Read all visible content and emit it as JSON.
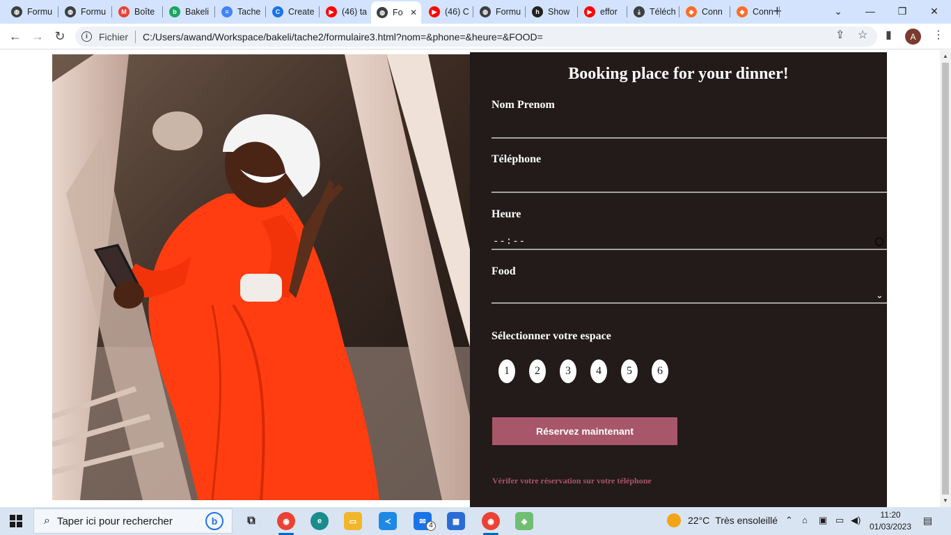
{
  "browser": {
    "tabs": [
      {
        "title": "Formu",
        "fav_color": "#3c4043",
        "fav_glyph": "◍"
      },
      {
        "title": "Formu",
        "fav_color": "#3c4043",
        "fav_glyph": "◍"
      },
      {
        "title": "Boîte",
        "fav_color": "#ea4335",
        "fav_glyph": "M"
      },
      {
        "title": "Bakeli",
        "fav_color": "#1ea362",
        "fav_glyph": "b"
      },
      {
        "title": "Tache",
        "fav_color": "#4285f4",
        "fav_glyph": "≡"
      },
      {
        "title": "Create",
        "fav_color": "#1a73e8",
        "fav_glyph": "C"
      },
      {
        "title": "(46) ta",
        "fav_color": "#ff0000",
        "fav_glyph": "▶"
      },
      {
        "title": "Fo",
        "fav_color": "#3c4043",
        "fav_glyph": "◍",
        "active": true
      },
      {
        "title": "(46) C",
        "fav_color": "#ff0000",
        "fav_glyph": "▶"
      },
      {
        "title": "Formu",
        "fav_color": "#3c4043",
        "fav_glyph": "◍"
      },
      {
        "title": "Show",
        "fav_color": "#222222",
        "fav_glyph": "h"
      },
      {
        "title": "effor",
        "fav_color": "#ff0000",
        "fav_glyph": "▶"
      },
      {
        "title": "Téléch",
        "fav_color": "#3c4043",
        "fav_glyph": "⤓"
      },
      {
        "title": "Conn",
        "fav_color": "#fc6d26",
        "fav_glyph": "◆"
      },
      {
        "title": "Conn",
        "fav_color": "#fc6d26",
        "fav_glyph": "◆"
      }
    ],
    "scheme_label": "Fichier",
    "url": "C:/Users/awand/Workspace/bakeli/tache2/formulaire3.html?nom=&phone=&heure=&FOOD=",
    "profile_initial": "A"
  },
  "form": {
    "title": "Booking place for your dinner!",
    "name_label": "Nom Prenom",
    "name_value": "",
    "phone_label": "Téléphone",
    "phone_value": "",
    "time_label": "Heure",
    "time_value": "--:--",
    "food_label": "Food",
    "food_value": "",
    "space_label": "Sélectionner votre espace",
    "seats": [
      "1",
      "2",
      "3",
      "4",
      "5",
      "6"
    ],
    "submit_label": "Réservez maintenant",
    "verify_text": "Vérifer votre réservation sur votre téléphone",
    "colors": {
      "panel_bg": "#231a1a",
      "accent": "#a8566a",
      "text": "#ffffff"
    }
  },
  "taskbar": {
    "search_placeholder": "Taper ici pour rechercher",
    "weather_temp": "22°C",
    "weather_text": "Très ensoleillé",
    "time": "11:20",
    "date": "01/03/2023",
    "mail_badge": "4"
  }
}
